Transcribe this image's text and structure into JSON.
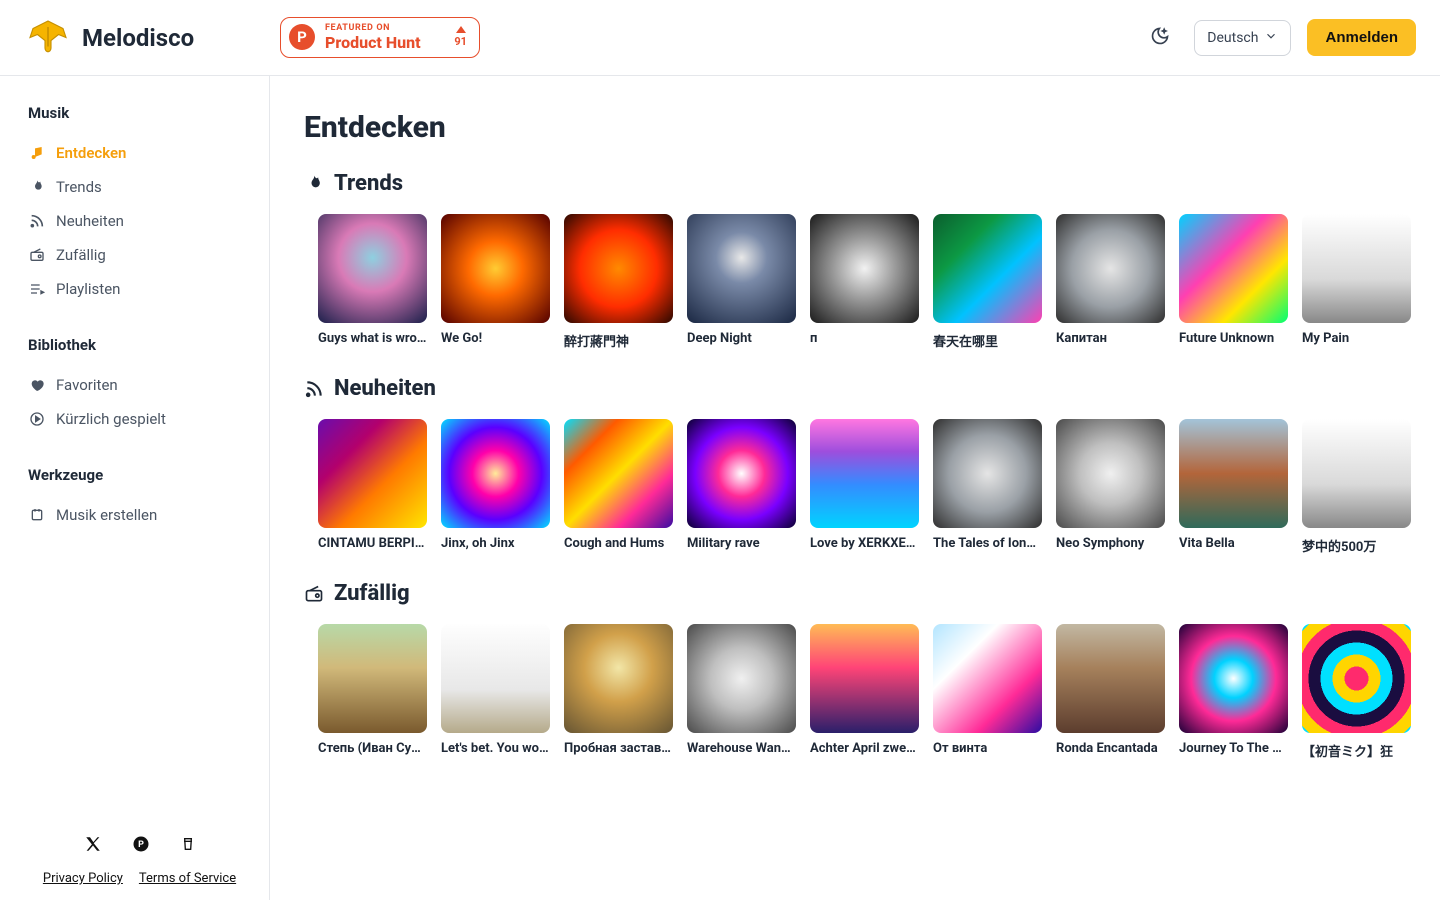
{
  "brand": {
    "name": "Melodisco"
  },
  "ph": {
    "featured": "FEATURED ON",
    "title": "Product Hunt",
    "votes": "91"
  },
  "header": {
    "language": "Deutsch",
    "signin": "Anmelden"
  },
  "sidebar": {
    "musik": {
      "heading": "Musik",
      "items": [
        {
          "label": "Entdecken",
          "active": true
        },
        {
          "label": "Trends",
          "active": false
        },
        {
          "label": "Neuheiten",
          "active": false
        },
        {
          "label": "Zufällig",
          "active": false
        },
        {
          "label": "Playlisten",
          "active": false
        }
      ]
    },
    "bibliothek": {
      "heading": "Bibliothek",
      "items": [
        {
          "label": "Favoriten"
        },
        {
          "label": "Kürzlich gespielt"
        }
      ]
    },
    "werkzeuge": {
      "heading": "Werkzeuge",
      "items": [
        {
          "label": "Musik erstellen"
        }
      ]
    },
    "footer": {
      "privacy": "Privacy Policy",
      "terms": "Terms of Service"
    }
  },
  "page": {
    "title": "Entdecken"
  },
  "sections": {
    "trends": {
      "title": "Trends",
      "items": [
        {
          "title": "Guys what is wro…"
        },
        {
          "title": "We Go!"
        },
        {
          "title": "醉打蔣門神"
        },
        {
          "title": "Deep Night"
        },
        {
          "title": "п"
        },
        {
          "title": "春天在哪里"
        },
        {
          "title": "Капитан"
        },
        {
          "title": "Future Unknown"
        },
        {
          "title": "My Pain"
        }
      ]
    },
    "neuheiten": {
      "title": "Neuheiten",
      "items": [
        {
          "title": "CINTAMU BERPI…"
        },
        {
          "title": "Jinx, oh Jinx"
        },
        {
          "title": "Cough and Hums"
        },
        {
          "title": "Military rave"
        },
        {
          "title": "Love by XERKXE…"
        },
        {
          "title": "The Tales of Iono…"
        },
        {
          "title": "Neo Symphony"
        },
        {
          "title": "Vita Bella"
        },
        {
          "title": "梦中的500万"
        }
      ]
    },
    "zufaellig": {
      "title": "Zufällig",
      "items": [
        {
          "title": "Степь (Иван Сур…"
        },
        {
          "title": "Let's bet. You wo…"
        },
        {
          "title": "Пробная застав…"
        },
        {
          "title": "Warehouse Wand…"
        },
        {
          "title": "Achter April zwei…"
        },
        {
          "title": "От винта"
        },
        {
          "title": "Ronda Encantada"
        },
        {
          "title": "Journey To The End"
        },
        {
          "title": "【初音ミク】狂"
        }
      ]
    }
  }
}
